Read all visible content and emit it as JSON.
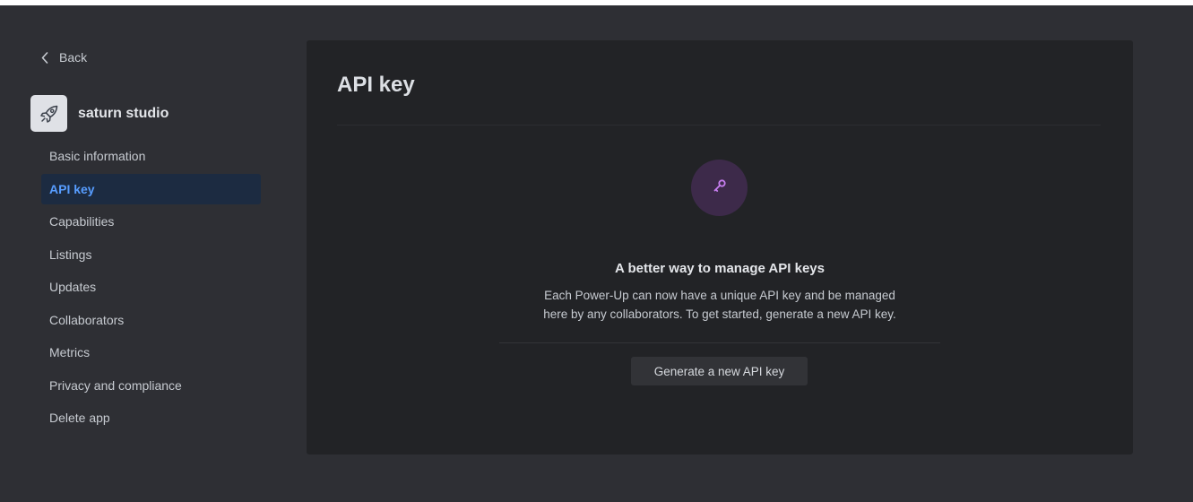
{
  "sidebar": {
    "back_label": "Back",
    "app_name": "saturn studio",
    "app_icon": "rocket-icon",
    "items": [
      {
        "label": "Basic information",
        "active": false
      },
      {
        "label": "API key",
        "active": true
      },
      {
        "label": "Capabilities",
        "active": false
      },
      {
        "label": "Listings",
        "active": false
      },
      {
        "label": "Updates",
        "active": false
      },
      {
        "label": "Collaborators",
        "active": false
      },
      {
        "label": "Metrics",
        "active": false
      },
      {
        "label": "Privacy and compliance",
        "active": false
      },
      {
        "label": "Delete app",
        "active": false
      }
    ]
  },
  "main": {
    "title": "API key",
    "empty_state": {
      "icon": "key-icon",
      "heading": "A better way to manage API keys",
      "description_line1": "Each Power-Up can now have a unique API key and be managed",
      "description_line2": "here by any collaborators. To get started, generate a new API key.",
      "button_label": "Generate a new API key"
    }
  },
  "colors": {
    "background": "#2e2f34",
    "panel": "#222326",
    "active_nav_bg": "#1c2b41",
    "active_nav_text": "#579dff",
    "key_circle": "#3d2a4a",
    "key_icon": "#c77ef0"
  }
}
